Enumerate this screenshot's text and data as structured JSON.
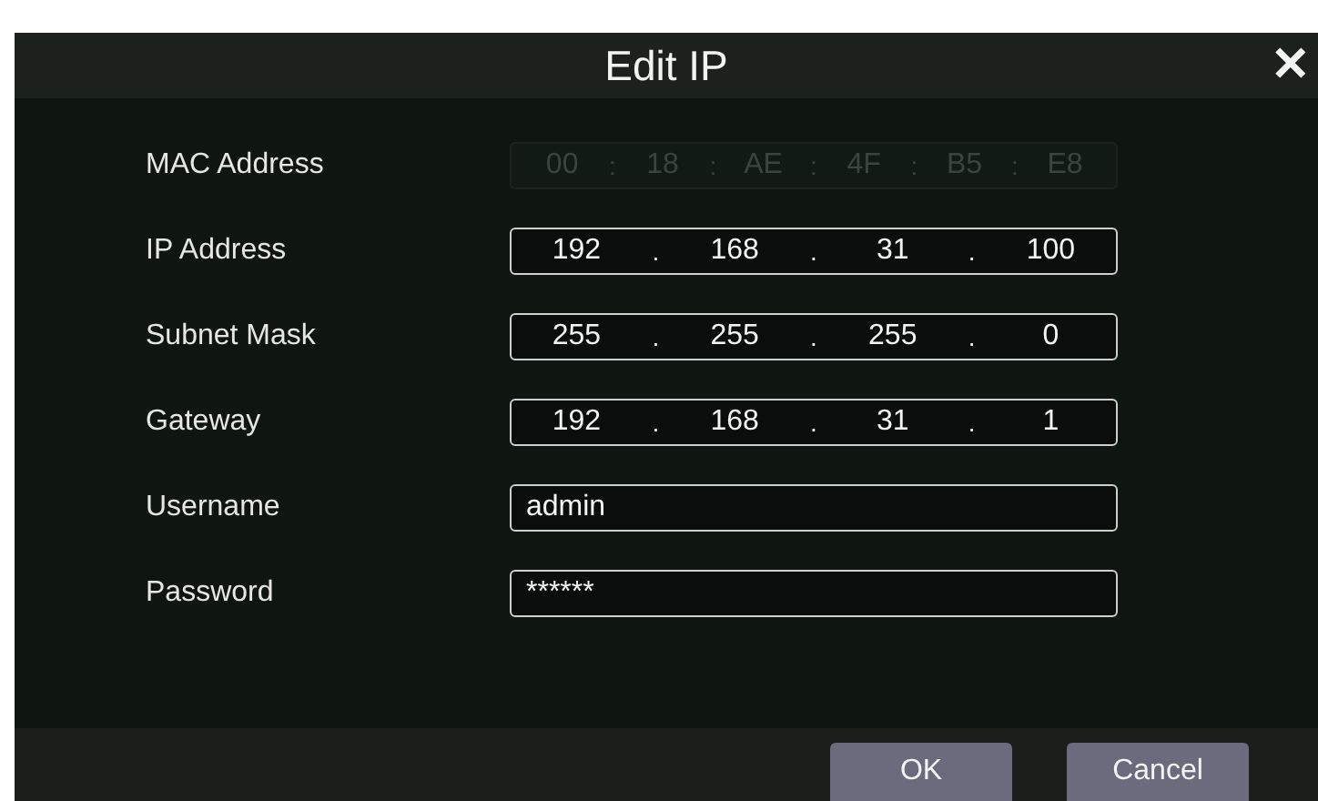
{
  "window": {
    "title": "Edit IP",
    "close": "✕"
  },
  "fields": [
    {
      "label": "MAC Address",
      "kind": "segments",
      "separator": ":",
      "disabled": true,
      "values": [
        "00",
        "18",
        "AE",
        "4F",
        "B5",
        "E8"
      ]
    },
    {
      "label": "IP Address",
      "kind": "segments",
      "separator": ".",
      "disabled": false,
      "values": [
        "192",
        "168",
        "31",
        "100"
      ]
    },
    {
      "label": "Subnet Mask",
      "kind": "segments",
      "separator": ".",
      "disabled": false,
      "values": [
        "255",
        "255",
        "255",
        "0"
      ]
    },
    {
      "label": "Gateway",
      "kind": "segments",
      "separator": ".",
      "disabled": false,
      "values": [
        "192",
        "168",
        "31",
        "1"
      ]
    },
    {
      "label": "Username",
      "kind": "text",
      "disabled": false,
      "value": "admin"
    },
    {
      "label": "Password",
      "kind": "text",
      "disabled": false,
      "value": "******"
    }
  ],
  "buttons": [
    "OK",
    "Cancel"
  ]
}
